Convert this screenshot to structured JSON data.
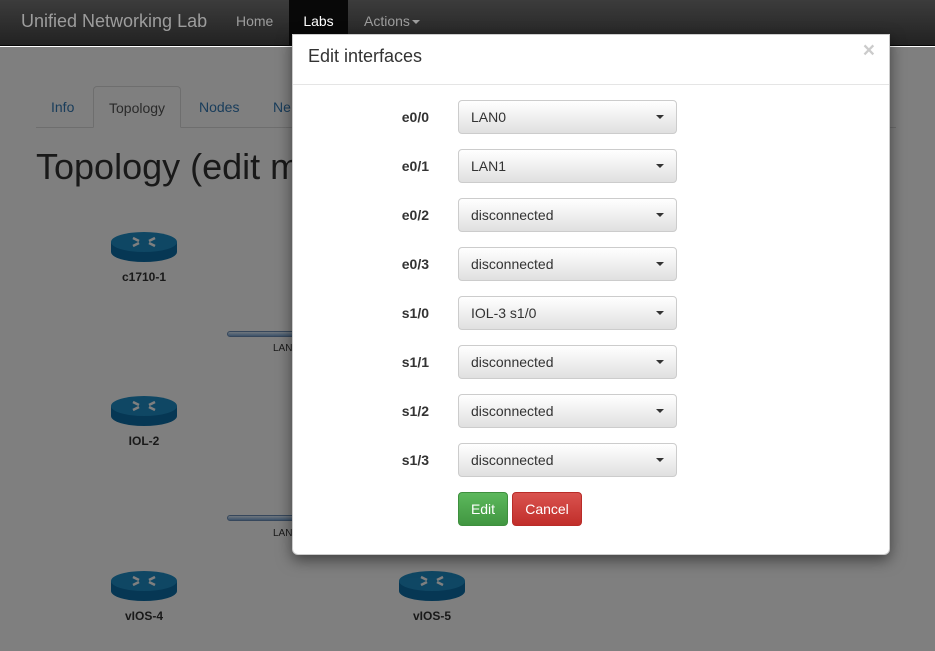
{
  "navbar": {
    "brand": "Unified Networking Lab",
    "items": {
      "home": "Home",
      "labs": "Labs",
      "actions": "Actions"
    }
  },
  "tabs": {
    "info": "Info",
    "topology": "Topology",
    "nodes": "Nodes",
    "networks": "Ne"
  },
  "page": {
    "title": "Topology (edit m"
  },
  "topology": {
    "nodes": {
      "c1710": "c1710-1",
      "iol2": "IOL-2",
      "vios4": "vIOS-4",
      "vios5": "vIOS-5"
    },
    "links": {
      "lan_a": "LAN",
      "lan_b": "LAN"
    }
  },
  "modal": {
    "title": "Edit interfaces",
    "close_symbol": "×",
    "interfaces": [
      {
        "name": "e0/0",
        "value": "LAN0"
      },
      {
        "name": "e0/1",
        "value": "LAN1"
      },
      {
        "name": "e0/2",
        "value": "disconnected"
      },
      {
        "name": "e0/3",
        "value": "disconnected"
      },
      {
        "name": "s1/0",
        "value": "IOL-3 s1/0"
      },
      {
        "name": "s1/1",
        "value": "disconnected"
      },
      {
        "name": "s1/2",
        "value": "disconnected"
      },
      {
        "name": "s1/3",
        "value": "disconnected"
      }
    ],
    "edit_label": "Edit",
    "cancel_label": "Cancel"
  },
  "colors": {
    "primary_button": "#5cb85c",
    "danger_button": "#d9534f",
    "link": "#337ab7",
    "router": "#1e8fc8"
  }
}
